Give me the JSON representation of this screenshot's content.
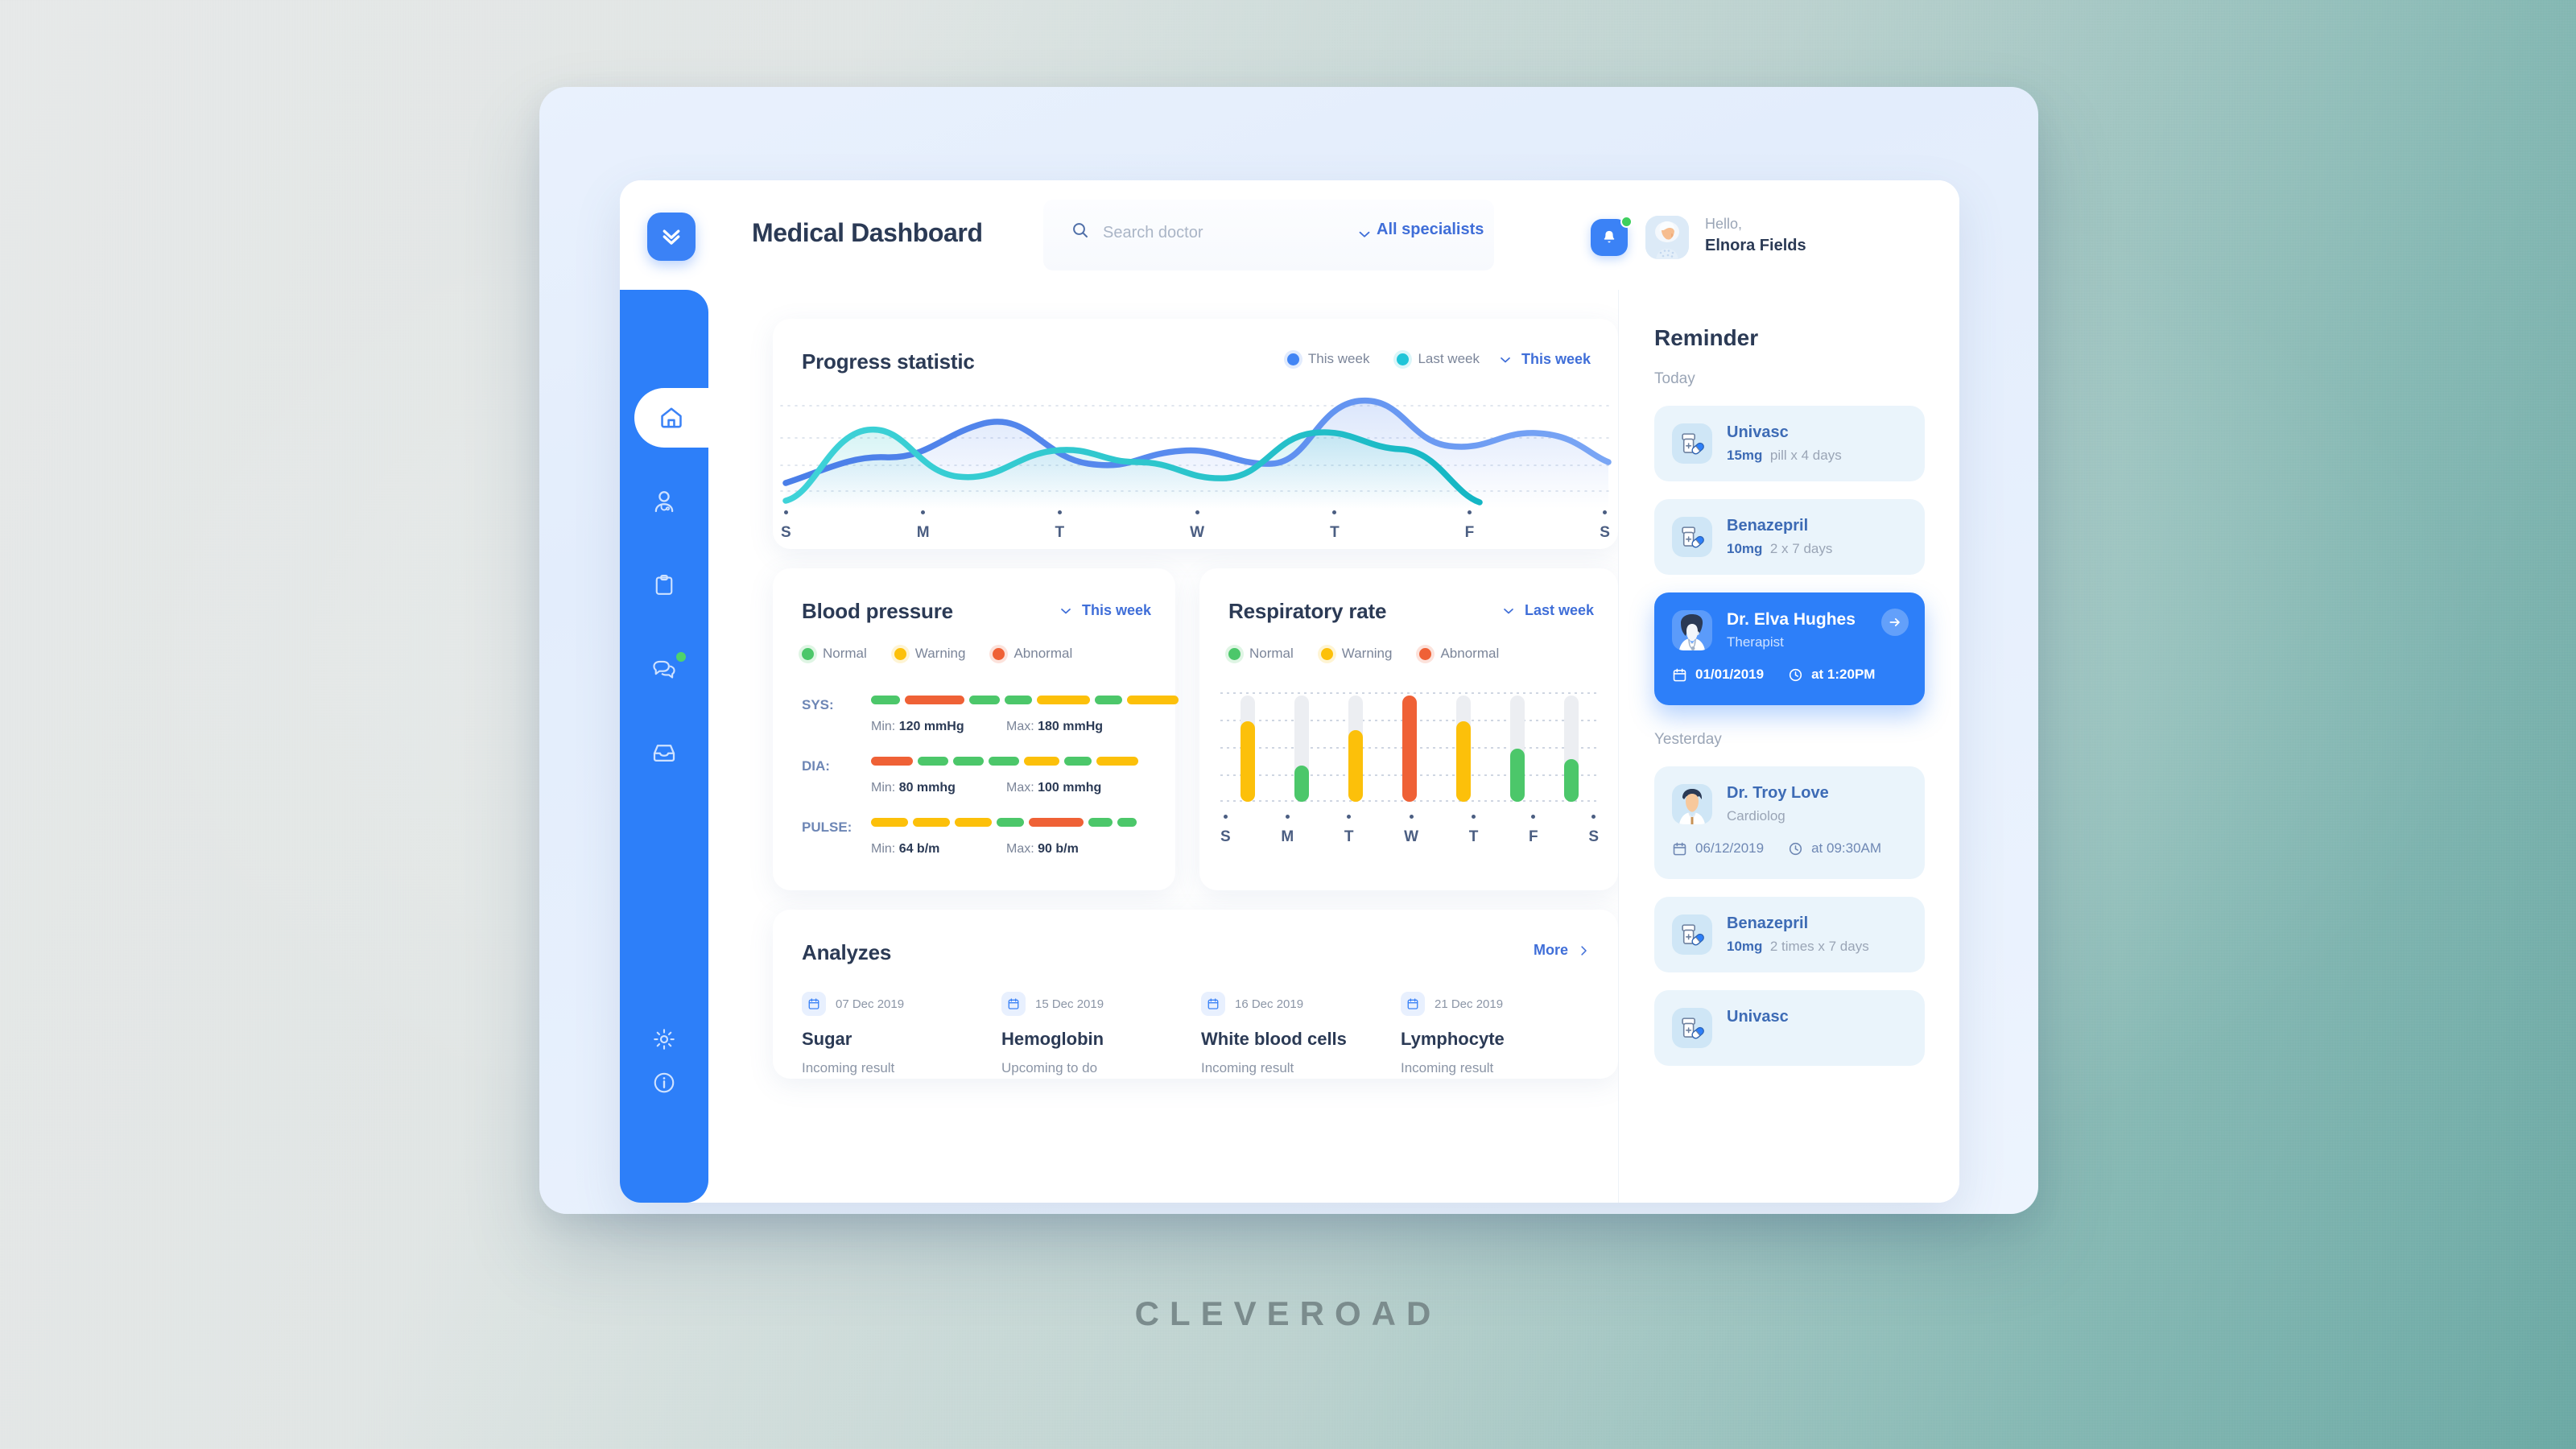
{
  "brand": {
    "wordmark": "CLEVEROAD"
  },
  "header": {
    "logo_icon": "chevron-double-down-logo-icon",
    "title": "Medical Dashboard",
    "search": {
      "icon": "search-icon",
      "placeholder": "Search doctor",
      "value": ""
    },
    "filter": {
      "chevron_icon": "chevron-down-icon",
      "label": "All specialists"
    },
    "notification": {
      "icon": "bell-icon",
      "has_badge": true,
      "badge_color": "#3ecf5e"
    },
    "user": {
      "avatar_icon": "user-avatar",
      "greeting": "Hello,",
      "name": "Elnora Fields"
    }
  },
  "sidebar": {
    "items": [
      {
        "icon": "home-icon",
        "name": "home",
        "active": true,
        "badge": false
      },
      {
        "icon": "doctor-icon",
        "name": "doctors",
        "active": false,
        "badge": false
      },
      {
        "icon": "clipboard-icon",
        "name": "records",
        "active": false,
        "badge": false
      },
      {
        "icon": "chat-icon",
        "name": "messages",
        "active": false,
        "badge": true
      },
      {
        "icon": "inbox-icon",
        "name": "inbox",
        "active": false,
        "badge": false
      }
    ],
    "bottom_items": [
      {
        "icon": "gear-icon",
        "name": "settings"
      },
      {
        "icon": "info-icon",
        "name": "info"
      }
    ]
  },
  "progress_card": {
    "title": "Progress statistic",
    "legend": [
      {
        "label": "This week",
        "color": "#4285f4"
      },
      {
        "label": "Last week",
        "color": "#20c5d8"
      }
    ],
    "period": {
      "label": "This week",
      "chevron_icon": "chevron-down-icon"
    }
  },
  "blood_pressure": {
    "title": "Blood pressure",
    "period": {
      "label": "This week",
      "chevron_icon": "chevron-down-icon"
    },
    "legend": [
      {
        "label": "Normal",
        "color": "#4cc76a"
      },
      {
        "label": "Warning",
        "color": "#fcc00a"
      },
      {
        "label": "Abnormal",
        "color": "#ef6136"
      }
    ],
    "rows": [
      {
        "label": "SYS:",
        "min_label": "Min:",
        "min_value": "120 mmHg",
        "max_label": "Max:",
        "max_value": "180 mmHg",
        "segments": [
          {
            "status": "normal",
            "width": 36
          },
          {
            "status": "abnormal",
            "width": 74
          },
          {
            "status": "normal",
            "width": 38
          },
          {
            "status": "normal",
            "width": 34
          },
          {
            "status": "warning",
            "width": 66
          },
          {
            "status": "normal",
            "width": 34
          },
          {
            "status": "warning",
            "width": 64
          }
        ]
      },
      {
        "label": "DIA:",
        "min_label": "Min:",
        "min_value": "80 mmhg",
        "max_label": "Max:",
        "max_value": "100 mmhg",
        "segments": [
          {
            "status": "abnormal",
            "width": 52
          },
          {
            "status": "normal",
            "width": 38
          },
          {
            "status": "normal",
            "width": 38
          },
          {
            "status": "normal",
            "width": 38
          },
          {
            "status": "warning",
            "width": 44
          },
          {
            "status": "normal",
            "width": 34
          },
          {
            "status": "warning",
            "width": 52
          }
        ]
      },
      {
        "label": "PULSE:",
        "min_label": "Min:",
        "min_value": "64 b/m",
        "max_label": "Max:",
        "max_value": "90 b/m",
        "segments": [
          {
            "status": "warning",
            "width": 46
          },
          {
            "status": "warning",
            "width": 46
          },
          {
            "status": "warning",
            "width": 46
          },
          {
            "status": "normal",
            "width": 34
          },
          {
            "status": "abnormal",
            "width": 68
          },
          {
            "status": "normal",
            "width": 30
          },
          {
            "status": "normal",
            "width": 24
          }
        ]
      }
    ]
  },
  "respiratory": {
    "title": "Respiratory rate",
    "period": {
      "label": "Last week",
      "chevron_icon": "chevron-down-icon"
    },
    "legend": [
      {
        "label": "Normal",
        "color": "#4cc76a"
      },
      {
        "label": "Warning",
        "color": "#fcc00a"
      },
      {
        "label": "Abnormal",
        "color": "#ef6136"
      }
    ]
  },
  "analyzes": {
    "title": "Analyzes",
    "more": {
      "label": "More",
      "chevron_icon": "chevron-right-icon"
    },
    "items": [
      {
        "date": "07 Dec 2019",
        "calendar_icon": "calendar-icon",
        "name": "Sugar",
        "status": "Incoming result"
      },
      {
        "date": "15 Dec 2019",
        "calendar_icon": "calendar-icon",
        "name": "Hemoglobin",
        "status": "Upcoming to do"
      },
      {
        "date": "16 Dec 2019",
        "calendar_icon": "calendar-icon",
        "name": "White blood cells",
        "status": "Incoming result"
      },
      {
        "date": "21 Dec 2019",
        "calendar_icon": "calendar-icon",
        "name": "Lymphocyte",
        "status": "Incoming result"
      }
    ]
  },
  "reminder": {
    "title": "Reminder",
    "groups": [
      {
        "label": "Today",
        "items": [
          {
            "type": "medication",
            "icon": "pill-bottle-icon",
            "name": "Univasc",
            "dose": "15mg",
            "schedule": "pill x 4 days",
            "highlight": false
          },
          {
            "type": "medication",
            "icon": "pill-bottle-icon",
            "name": "Benazepril",
            "dose": "10mg",
            "schedule": "2 x 7 days",
            "highlight": false
          },
          {
            "type": "appointment",
            "icon": "doctor-female-avatar",
            "name": "Dr. Elva Hughes",
            "role": "Therapist",
            "date": "01/01/2019",
            "time": "at 1:20PM",
            "calendar_icon": "calendar-icon",
            "clock_icon": "clock-icon",
            "arrow_icon": "arrow-right-icon",
            "highlight": true
          }
        ]
      },
      {
        "label": "Yesterday",
        "items": [
          {
            "type": "appointment",
            "icon": "doctor-male-avatar",
            "name": "Dr. Troy Love",
            "role": "Cardiolog",
            "date": "06/12/2019",
            "time": "at 09:30AM",
            "calendar_icon": "calendar-icon",
            "clock_icon": "clock-icon",
            "highlight": false
          },
          {
            "type": "medication",
            "icon": "pill-bottle-icon",
            "name": "Benazepril",
            "dose": "10mg",
            "schedule": "2 times  x 7 days",
            "highlight": false
          },
          {
            "type": "medication",
            "icon": "pill-bottle-icon",
            "name": "Univasc",
            "dose": "",
            "schedule": "",
            "highlight": false
          }
        ]
      }
    ]
  },
  "chart_data": [
    {
      "type": "line",
      "title": "Progress statistic",
      "categories": [
        "S",
        "M",
        "T",
        "W",
        "T",
        "F",
        "S"
      ],
      "xlabel": "",
      "ylabel": "",
      "ylim": [
        0,
        100
      ],
      "grid": true,
      "legend_position": "top-right",
      "series": [
        {
          "name": "This week",
          "color": "#4f80ea",
          "values": [
            18,
            36,
            74,
            50,
            42,
            96,
            58
          ]
        },
        {
          "name": "Last week",
          "color": "#20c5d8",
          "values": [
            8,
            66,
            26,
            48,
            22,
            62,
            6
          ]
        }
      ]
    },
    {
      "type": "bar",
      "title": "Respiratory rate",
      "categories": [
        "S",
        "M",
        "T",
        "W",
        "T",
        "F",
        "S"
      ],
      "xlabel": "",
      "ylabel": "",
      "ylim": [
        0,
        100
      ],
      "grid": true,
      "values": [
        76,
        34,
        68,
        100,
        76,
        50,
        40
      ],
      "statuses": [
        "warning",
        "normal",
        "warning",
        "abnormal",
        "warning",
        "normal",
        "normal"
      ],
      "track_values": [
        100,
        100,
        100,
        100,
        100,
        100,
        100
      ],
      "colors": {
        "normal": "#4cc76a",
        "warning": "#fcc00a",
        "abnormal": "#ef6136",
        "track": "#eceef2"
      }
    }
  ]
}
